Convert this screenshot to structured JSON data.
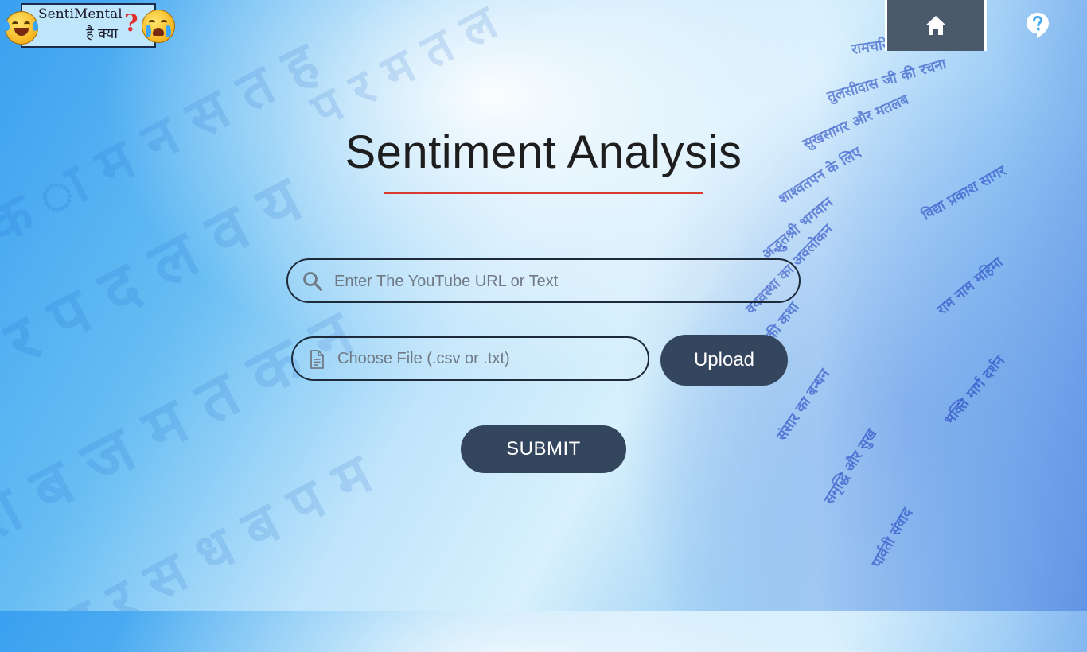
{
  "logo": {
    "brand": "SentiMental",
    "subtitle": "है क्या",
    "question_mark": "?",
    "left_emoji": "laughing-with-tears-emoji",
    "right_emoji": "crying-emoji"
  },
  "nav": {
    "home_icon": "home-icon",
    "help_icon": "help-bubble-icon"
  },
  "main": {
    "title": "Sentiment Analysis",
    "search": {
      "icon": "search-icon",
      "placeholder": "Enter The YouTube URL or Text",
      "value": ""
    },
    "file": {
      "icon": "file-icon",
      "placeholder": "Choose File (.csv or .txt)"
    },
    "upload_label": "Upload",
    "submit_label": "SUBMIT"
  },
  "colors": {
    "button_bg": "#34465e",
    "nav_bg": "#4a5a6a",
    "underline": "#d83a2e",
    "title_text": "#1e1e1e",
    "input_border": "#1d2a3a"
  }
}
